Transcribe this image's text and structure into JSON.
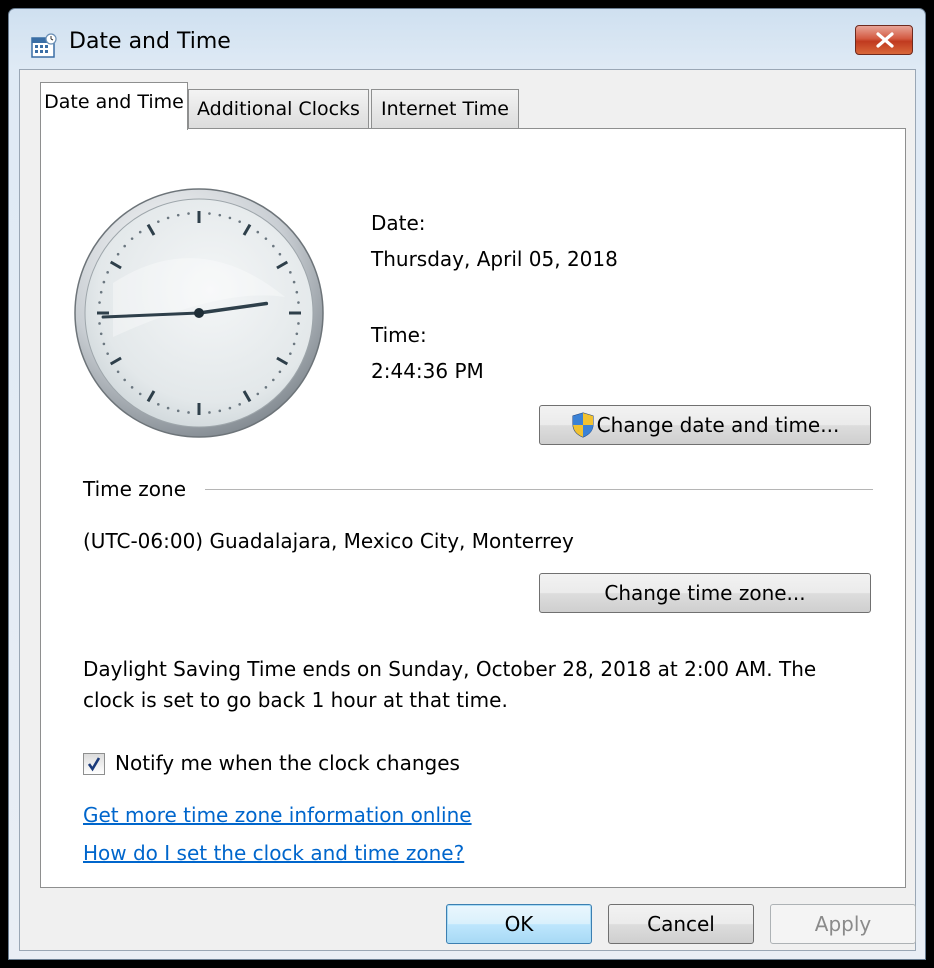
{
  "window": {
    "title": "Date and Time",
    "icon": "calendar-clock-icon",
    "close_icon": "close-icon"
  },
  "tabs": [
    {
      "label": "Date and Time",
      "active": true
    },
    {
      "label": "Additional Clocks",
      "active": false
    },
    {
      "label": "Internet Time",
      "active": false
    }
  ],
  "clock": {
    "hour": 2,
    "minute": 44,
    "second": 36
  },
  "date": {
    "label": "Date:",
    "value": "Thursday, April 05, 2018"
  },
  "time": {
    "label": "Time:",
    "value": "2:44:36 PM"
  },
  "change_datetime_button": {
    "label": "Change date and time...",
    "icon": "uac-shield-icon"
  },
  "timezone": {
    "heading": "Time zone",
    "value": "(UTC-06:00) Guadalajara, Mexico City, Monterrey",
    "change_button": "Change time zone..."
  },
  "dst": {
    "line1": "Daylight Saving Time ends on Sunday, October 28, 2018 at 2:00 AM. The",
    "line2": "clock is set to go back 1 hour at that time."
  },
  "notify": {
    "label": "Notify me when the clock changes",
    "checked": true
  },
  "links": {
    "more_info": "Get more time zone information online",
    "how_to": "How do I set the clock and time zone?"
  },
  "footer": {
    "ok": "OK",
    "cancel": "Cancel",
    "apply": "Apply"
  }
}
